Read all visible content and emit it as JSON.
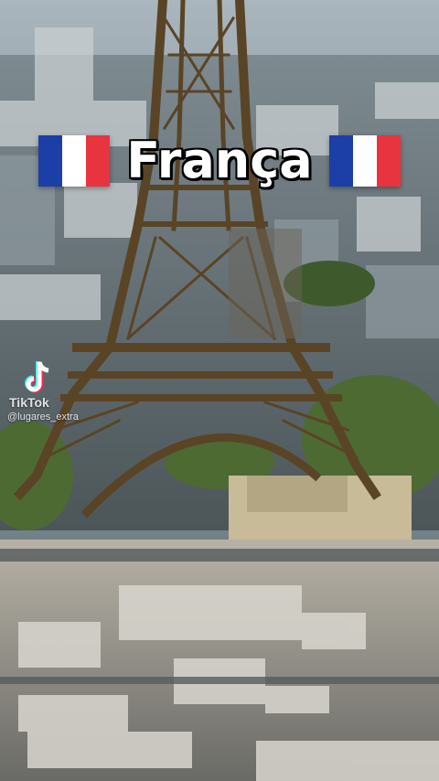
{
  "video": {
    "title": "França",
    "left_flag": "france-flag",
    "right_flag": "france-flag"
  },
  "watermark": {
    "brand": "TikTok",
    "handle": "@lugares_extra",
    "icon": "tiktok-logo-icon"
  },
  "colors": {
    "flag_blue": "#1b3fa6",
    "flag_white": "#ffffff",
    "flag_red": "#e8343f",
    "title_text": "#ffffff",
    "tower": "#5a4426"
  }
}
